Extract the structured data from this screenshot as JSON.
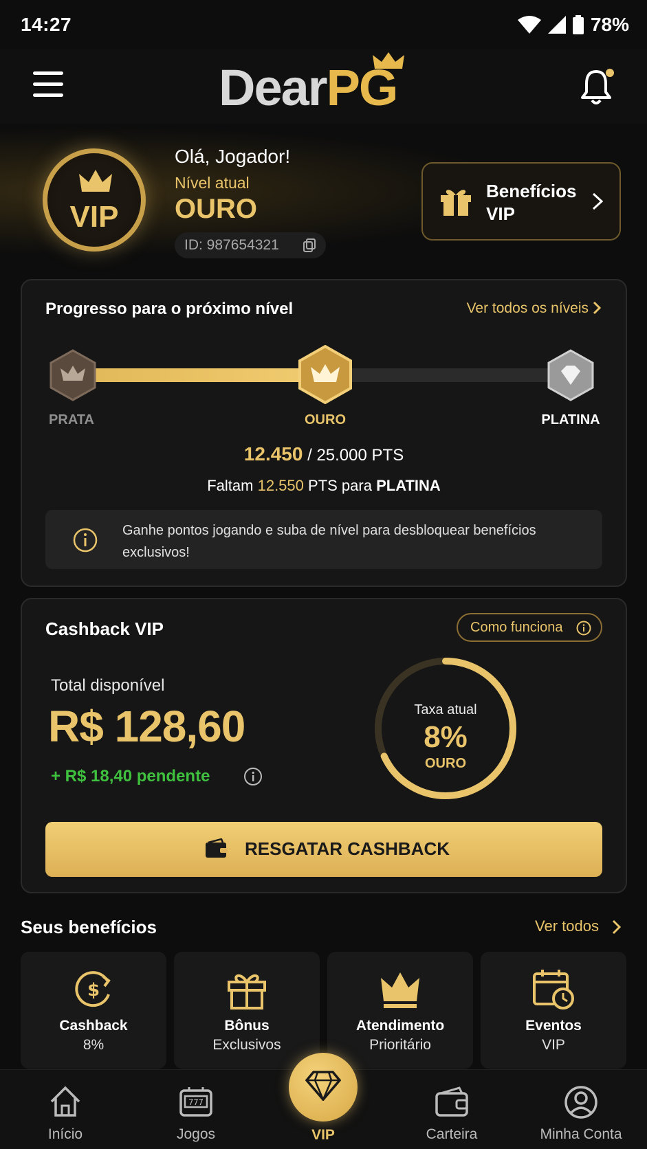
{
  "status_bar": {
    "time": "14:27",
    "battery": "78%"
  },
  "header": {
    "logo_part1": "Dear",
    "logo_part2": "PG"
  },
  "profile": {
    "badge_text": "VIP",
    "greeting": "Olá, Jogador!",
    "level_label": "Nível atual",
    "level_value": "OURO",
    "id_text": "ID: 987654321",
    "benefits_button": "Benefícios VIP"
  },
  "progress": {
    "title": "Progresso para o próximo nível",
    "view_all_levels": "Ver todos os níveis",
    "tiers": [
      "PRATA",
      "OURO",
      "PLATINA"
    ],
    "current_points": "12.450",
    "target_points": "/ 25.000 PTS",
    "progress_fraction": 0.5,
    "remaining_prefix": "Faltam",
    "remaining_value": "12.550",
    "remaining_middle": "PTS para",
    "remaining_tier": "PLATINA",
    "info_text": "Ganhe pontos jogando e suba de nível para desbloquear benefícios exclusivos!"
  },
  "cashback": {
    "title": "Cashback VIP",
    "how_it_works": "Como funciona",
    "total_label": "Total disponível",
    "total_value": "R$ 128,60",
    "pending": "+ R$ 18,40 pendente",
    "rate_label": "Taxa atual",
    "rate_value": "8%",
    "rate_tier": "OURO",
    "redeem_button": "RESGATAR CASHBACK"
  },
  "benefits": {
    "title": "Seus benefícios",
    "view_all": "Ver todos",
    "items": [
      {
        "title": "Cashback",
        "subtitle": "8%",
        "icon": "cashback-icon"
      },
      {
        "title": "Bônus",
        "subtitle": "Exclusivos",
        "icon": "gift-icon"
      },
      {
        "title": "Atendimento",
        "subtitle": "Prioritário",
        "icon": "crown-icon"
      },
      {
        "title": "Eventos",
        "subtitle": "VIP",
        "icon": "calendar-icon"
      }
    ]
  },
  "nav": {
    "items": [
      "Início",
      "Jogos",
      "VIP",
      "Carteira",
      "Minha Conta"
    ]
  },
  "colors": {
    "accent": "#e9c46a",
    "background": "#0d0d0d",
    "pending_green": "#3fc13f"
  }
}
